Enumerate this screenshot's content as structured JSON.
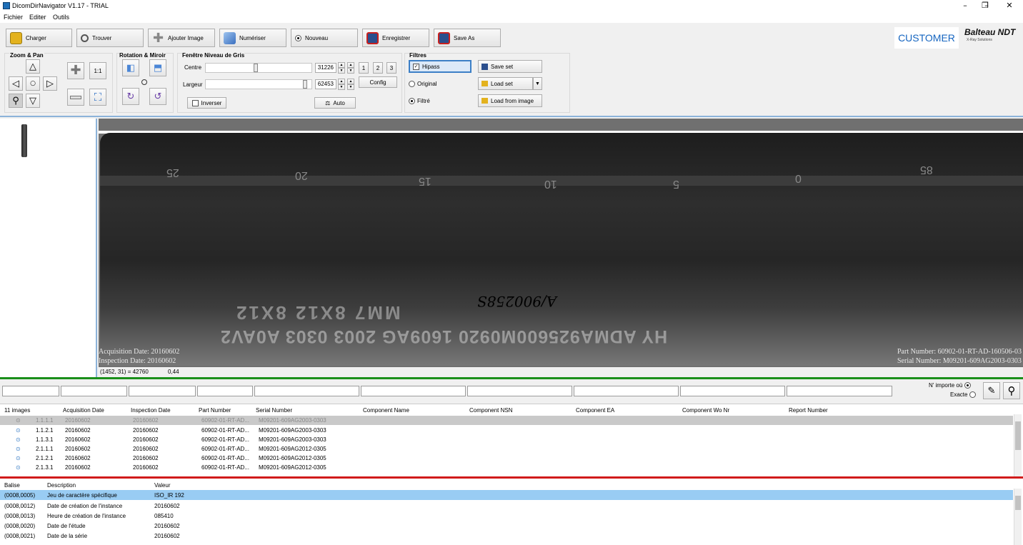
{
  "window": {
    "title": "DicomDirNavigator V1.17 - TRIAL",
    "minimize": "–",
    "restore": "❐",
    "close": "✕"
  },
  "menu": [
    "Fichier",
    "Editer",
    "Outils"
  ],
  "toolbar": {
    "buttons": [
      {
        "label": "Charger",
        "icon": "folder-icon",
        "color": "#e3b21e"
      },
      {
        "label": "Trouver",
        "icon": "magnifier-icon",
        "color": "#777777"
      },
      {
        "label": "Ajouter Image",
        "icon": "add-icon",
        "color": "#888888"
      },
      {
        "label": "Numériser",
        "icon": "scanner-icon",
        "color": "#3a6fbf"
      },
      {
        "label": "Nouveau",
        "icon": "radio-icon",
        "color": "#333333"
      },
      {
        "label": "Enregistrer",
        "icon": "save-icon",
        "color": "#c8201f"
      },
      {
        "label": "Save As",
        "icon": "save-as-icon",
        "color": "#c8201f"
      }
    ],
    "customer": "CUSTOMER",
    "brand": "Balteau NDT",
    "brand_tag": "X-Ray Solutions"
  },
  "zoom": {
    "title": "Zoom & Pan",
    "one_to_one": "1:1"
  },
  "rotation": {
    "title": "Rotation & Miroir"
  },
  "window_level": {
    "title": "Fenêtre Niveau de Gris",
    "centre_label": "Centre",
    "centre_value": "31226",
    "width_label": "Largeur",
    "width_value": "62453",
    "presets": [
      "1",
      "2",
      "3"
    ],
    "config": "Config",
    "invert": "Inverser",
    "auto": "Auto"
  },
  "filters": {
    "title": "Filtres",
    "hipass": "Hipass",
    "original": "Original",
    "filtered": "Filtré",
    "save_set": "Save set",
    "load_set": "Load set",
    "load_from_image": "Load from image"
  },
  "viewer": {
    "acq_date": "Acquisition Date: 20160602",
    "insp_date": "Inspection Date: 20160602",
    "part_number": "Part Number: 60902-01-RT-AD-160506-03",
    "serial_number": "Serial Number: M09201-609AG2003-0303",
    "cursor": "(1452, 31) = 42760",
    "zoom": "0,44",
    "scale_marks": [
      "25",
      "20",
      "15",
      "10",
      "5",
      "0",
      "85"
    ],
    "bottom_text_1": "MM7 8X12 8X12",
    "bottom_text_2": "HY ADMA925600M0920 1609AG 2003 0303 A0AV2",
    "handwritten": "A/900258S"
  },
  "search": {
    "anywhere": "N' importe où",
    "exact": "Exacte"
  },
  "list": {
    "headers": [
      "11 images",
      "Acquisition Date",
      "Inspection Date",
      "Part Number",
      "Serial Number",
      "Component Name",
      "Component NSN",
      "Component EA",
      "Component Wo Nr",
      "Report Number"
    ],
    "rows": [
      [
        "1.1.1.1",
        "20160602",
        "20160602",
        "60902-01-RT-AD...",
        "M09201-609AG2003-0303"
      ],
      [
        "1.1.2.1",
        "20160602",
        "20160602",
        "60902-01-RT-AD...",
        "M09201-609AG2003-0303"
      ],
      [
        "1.1.3.1",
        "20160602",
        "20160602",
        "60902-01-RT-AD...",
        "M09201-609AG2003-0303"
      ],
      [
        "2.1.1.1",
        "20160602",
        "20160602",
        "60902-01-RT-AD...",
        "M09201-609AG2012-0305"
      ],
      [
        "2.1.2.1",
        "20160602",
        "20160602",
        "60902-01-RT-AD...",
        "M09201-609AG2012-0305"
      ],
      [
        "2.1.3.1",
        "20160602",
        "20160602",
        "60902-01-RT-AD...",
        "M09201-609AG2012-0305"
      ]
    ]
  },
  "tags": {
    "headers": [
      "Balise",
      "Description",
      "Valeur"
    ],
    "rows": [
      [
        "(0008,0005)",
        "Jeu de caractère spécifique",
        "ISO_IR 192"
      ],
      [
        "(0008,0012)",
        "Date de création de l'instance",
        "20160602"
      ],
      [
        "(0008,0013)",
        "Heure de création de l'instance",
        "085410"
      ],
      [
        "(0008,0020)",
        "Date de l'étude",
        "20160602"
      ],
      [
        "(0008,0021)",
        "Date de la série",
        "20160602"
      ]
    ]
  },
  "colors": {
    "selection": "#99ccf3",
    "accent": "#1565c0",
    "green": "#1a8f1a",
    "red": "#d11b1b"
  }
}
